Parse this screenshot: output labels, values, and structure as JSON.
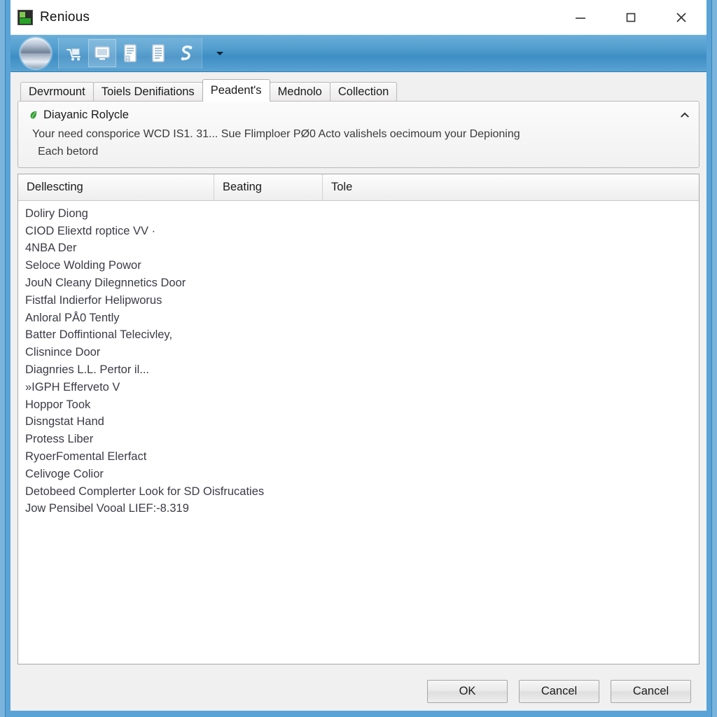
{
  "window": {
    "title": "Renious",
    "app_icon": "app-icon",
    "controls": {
      "minimize": "minimize-icon",
      "maximize": "maximize-icon",
      "close": "close-icon"
    },
    "frame_color": "#59a3d6"
  },
  "toolbar": {
    "orb": "globe-orb-button",
    "items": [
      {
        "name": "cart-icon"
      },
      {
        "name": "monitor-icon"
      },
      {
        "name": "document-bookmark-icon"
      },
      {
        "name": "document-lines-icon"
      },
      {
        "name": "s-curve-icon"
      }
    ],
    "overflow": "chevron-down-icon"
  },
  "tabs": [
    {
      "label": "Devrmount",
      "active": false
    },
    {
      "label": "Toiels Denifiations",
      "active": false
    },
    {
      "label": "Peadent's",
      "active": true
    },
    {
      "label": "Mednolo",
      "active": false
    },
    {
      "label": "Collection",
      "active": false
    }
  ],
  "info": {
    "icon": "green-leaf-icon",
    "title": "Diayanic Rolycle",
    "line1": "Your need consporice WCD IS1. 31... Sue Flimploer PØ0 Acto valishels oecimoum your Depioning",
    "line2": "Each betord",
    "collapse": "chevron-up-icon"
  },
  "list": {
    "columns": [
      "Dellescting",
      "Beating",
      "Tole"
    ],
    "rows": [
      {
        "c0": "Doliry Diong",
        "c1": "",
        "c2": ""
      },
      {
        "c0": "CIOD Eliextd roptice VV ·",
        "c1": "",
        "c2": ""
      },
      {
        "c0": "4NBA Der",
        "c1": "",
        "c2": ""
      },
      {
        "c0": "Seloce Wolding Powor",
        "c1": "",
        "c2": ""
      },
      {
        "c0": "JouN Cleany Dilegnnetics Door",
        "c1": "",
        "c2": ""
      },
      {
        "c0": "Fistfal Indierfor Helipworus",
        "c1": "",
        "c2": ""
      },
      {
        "c0": "Anloral PÅ0 Tently",
        "c1": "",
        "c2": ""
      },
      {
        "c0": "Batter Doffintional Telecivley,",
        "c1": "",
        "c2": ""
      },
      {
        "c0": "Clisnince Door",
        "c1": "",
        "c2": ""
      },
      {
        "c0": "Diagnries L.L. Pertor il...",
        "c1": "",
        "c2": ""
      },
      {
        "c0": "»IGPH Efferveto V",
        "c1": "",
        "c2": ""
      },
      {
        "c0": "Hoppor Took",
        "c1": "",
        "c2": ""
      },
      {
        "c0": "Disngstat Hand",
        "c1": "",
        "c2": ""
      },
      {
        "c0": "Protess Liber",
        "c1": "",
        "c2": ""
      },
      {
        "c0": "RyoerFomental Elerfact",
        "c1": "",
        "c2": ""
      },
      {
        "c0": "Celivoge Colior",
        "c1": "",
        "c2": ""
      },
      {
        "c0": "Detobeed Complerter Look for SD  Oisfrucaties",
        "c1": "",
        "c2": ""
      },
      {
        "c0": "Jow Pensibel Vooal LIEF:-8.319",
        "c1": "",
        "c2": ""
      }
    ]
  },
  "footer": {
    "ok": "OK",
    "cancel": "Cancel",
    "cancel2": "Cancel"
  }
}
